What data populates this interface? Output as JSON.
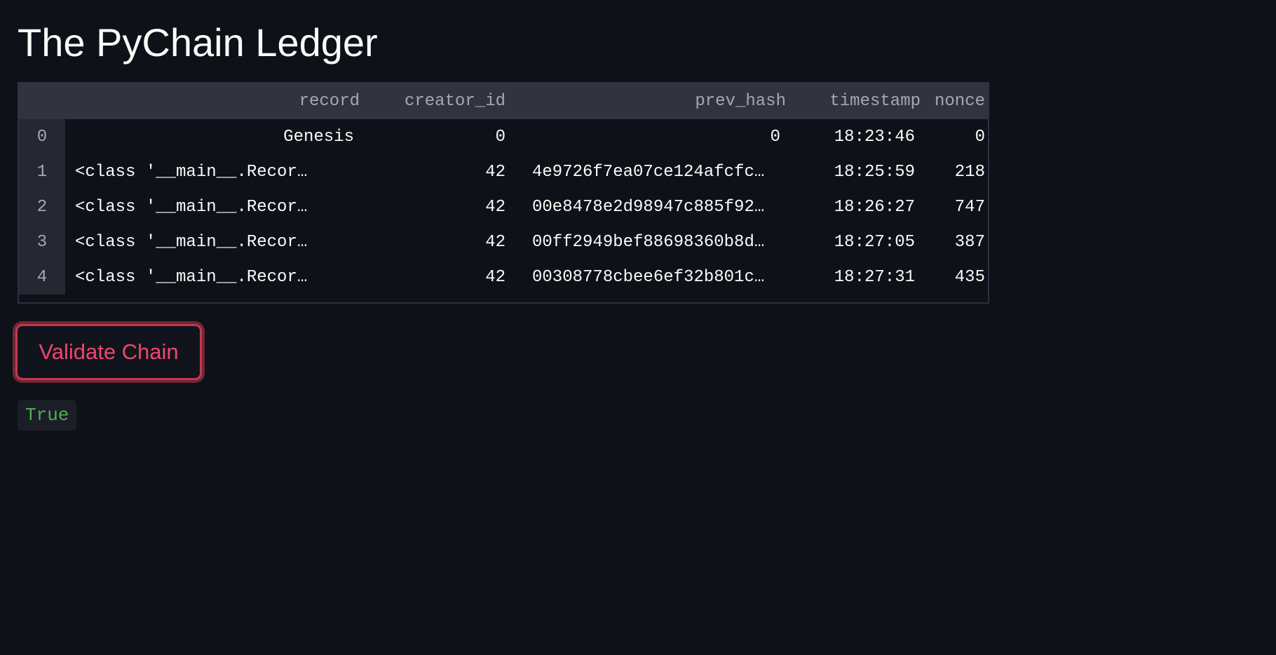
{
  "page": {
    "title": "The PyChain Ledger"
  },
  "ledger": {
    "columns": [
      "record",
      "creator_id",
      "prev_hash",
      "timestamp",
      "nonce"
    ],
    "rows": [
      {
        "index": "0",
        "record": "Genesis",
        "creator_id": "0",
        "prev_hash": "0",
        "timestamp": "18:23:46",
        "nonce": "0"
      },
      {
        "index": "1",
        "record": "<class '__main__.Recor…",
        "creator_id": "42",
        "prev_hash": "4e9726f7ea07ce124afcfc…",
        "timestamp": "18:25:59",
        "nonce": "218"
      },
      {
        "index": "2",
        "record": "<class '__main__.Recor…",
        "creator_id": "42",
        "prev_hash": "00e8478e2d98947c885f92…",
        "timestamp": "18:26:27",
        "nonce": "747"
      },
      {
        "index": "3",
        "record": "<class '__main__.Recor…",
        "creator_id": "42",
        "prev_hash": "00ff2949bef88698360b8d…",
        "timestamp": "18:27:05",
        "nonce": "387"
      },
      {
        "index": "4",
        "record": "<class '__main__.Recor…",
        "creator_id": "42",
        "prev_hash": "00308778cbee6ef32b801c…",
        "timestamp": "18:27:31",
        "nonce": "435"
      }
    ]
  },
  "actions": {
    "validate_label": "Validate Chain"
  },
  "result": {
    "value": "True"
  },
  "colors": {
    "background": "#0e1117",
    "header_bg": "#31333f",
    "accent": "#f0466b",
    "success": "#4fb04f"
  }
}
